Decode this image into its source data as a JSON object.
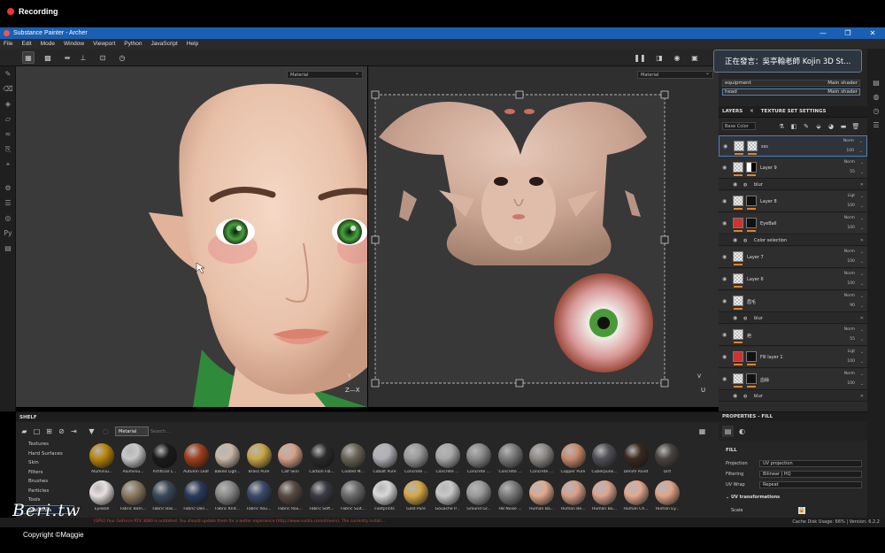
{
  "recording": {
    "label": "Recording"
  },
  "window": {
    "title": "Substance Painter - Archer",
    "minimize": "—",
    "maximize": "❐",
    "close": "✕"
  },
  "menu": [
    "File",
    "Edit",
    "Mode",
    "Window",
    "Viewport",
    "Python",
    "JavaScript",
    "Help"
  ],
  "viewport3d": {
    "mode": "Material"
  },
  "viewport2d": {
    "mode": "Material"
  },
  "notification": {
    "text": "正在發言：吳亭翰老師 Kojin 3D St..."
  },
  "texture_sets": [
    {
      "name": "equipment",
      "shader": "Main shader"
    },
    {
      "name": "head",
      "shader": "Main shader"
    }
  ],
  "layers_panel": {
    "tab_layers": "LAYERS",
    "tab_tss": "TEXTURE SET SETTINGS",
    "blend_select": "Base Color"
  },
  "layers": [
    {
      "name": "sss",
      "blend": "Norm",
      "opacity": "100",
      "kind": "main",
      "thumb": "checker",
      "mask": "checker",
      "selected": true
    },
    {
      "name": "Layer 9",
      "blend": "Norm",
      "opacity": "55",
      "kind": "main",
      "thumb": "checker",
      "mask": "mask"
    },
    {
      "name": "blur",
      "kind": "sub"
    },
    {
      "name": "Layer 8",
      "blend": "Ligt",
      "opacity": "100",
      "kind": "main",
      "thumb": "checker",
      "mask": "dark"
    },
    {
      "name": "EyeBall",
      "blend": "Norm",
      "opacity": "100",
      "kind": "main",
      "thumb": "red",
      "mask": "dark"
    },
    {
      "name": "Color selection",
      "kind": "sub"
    },
    {
      "name": "Layer 7",
      "blend": "Norm",
      "opacity": "100",
      "kind": "main",
      "thumb": "checker"
    },
    {
      "name": "Layer 6",
      "blend": "Norm",
      "opacity": "100",
      "kind": "main",
      "thumb": "checker"
    },
    {
      "name": "眉毛",
      "blend": "Norm",
      "opacity": "90",
      "kind": "main",
      "thumb": "checker"
    },
    {
      "name": "blur",
      "kind": "sub"
    },
    {
      "name": "疤",
      "blend": "Norm",
      "opacity": "55",
      "kind": "main",
      "thumb": "checker"
    },
    {
      "name": "Fill layer 1",
      "blend": "Ligt",
      "opacity": "100",
      "kind": "main",
      "thumb": "red",
      "mask": "dark"
    },
    {
      "name": "血絲",
      "blend": "Norm",
      "opacity": "100",
      "kind": "main",
      "thumb": "checker",
      "mask": "dark"
    },
    {
      "name": "blur",
      "kind": "sub"
    }
  ],
  "properties": {
    "header": "PROPERTIES - FILL",
    "section": "FILL",
    "rows": [
      {
        "label": "Projection",
        "value": "UV projection"
      },
      {
        "label": "Filtering",
        "value": "Bilinear | HQ"
      },
      {
        "label": "UV Wrap",
        "value": "Repeat"
      }
    ],
    "uv_transformations": "UV transformations",
    "scale_label": "Scale"
  },
  "shelf": {
    "header": "SHELF",
    "filter_chip": "Metarial",
    "search_placeholder": "Search...",
    "categories": [
      "Textures",
      "Hard Surfaces",
      "Skin",
      "Filters",
      "Brushes",
      "Particles",
      "Tools",
      "Materials"
    ],
    "selected_category": "Materials",
    "materials_row1": [
      {
        "name": "Aluminiu...",
        "color": "#b8860b"
      },
      {
        "name": "Aluminiu...",
        "color": "#c8c8c8"
      },
      {
        "name": "Artificial L...",
        "color": "#1a1a1a"
      },
      {
        "name": "Autumn Leaf",
        "color": "#a0401c"
      },
      {
        "name": "Baked Ligh...",
        "color": "#c9b8a6"
      },
      {
        "name": "Brass Pure",
        "color": "#c9a646"
      },
      {
        "name": "Calf Skin",
        "color": "#d6a288"
      },
      {
        "name": "Carbon Fib...",
        "color": "#2a2a2a"
      },
      {
        "name": "Coated M...",
        "color": "#6a6458"
      },
      {
        "name": "Cobalt Pure",
        "color": "#b0b0b8"
      },
      {
        "name": "Concrete ...",
        "color": "#9a9a9a"
      },
      {
        "name": "Concrete ...",
        "color": "#a8a8a8"
      },
      {
        "name": "Concrete ...",
        "color": "#8a8a8a"
      },
      {
        "name": "Concrete ...",
        "color": "#7a7a7a"
      },
      {
        "name": "Concrete ...",
        "color": "#8e8a84"
      },
      {
        "name": "Copper Pure",
        "color": "#c98a6a"
      },
      {
        "name": "Cuberpunk...",
        "color": "#505058"
      },
      {
        "name": "Denim Rivet",
        "color": "#3a2a1e"
      },
      {
        "name": "Dirt",
        "color": "#4a4440"
      }
    ],
    "materials_row2": [
      {
        "name": "EyeBall",
        "color": "#e8e0e0"
      },
      {
        "name": "Fabric Bam...",
        "color": "#8a7a60"
      },
      {
        "name": "Fabric Bas...",
        "color": "#3a4a5a"
      },
      {
        "name": "Fabric Den...",
        "color": "#2a3a5a"
      },
      {
        "name": "Fabric Knit...",
        "color": "#8a8a8a"
      },
      {
        "name": "Fabric Rou...",
        "color": "#3a4a6a"
      },
      {
        "name": "Fabric Rou...",
        "color": "#5a4a44"
      },
      {
        "name": "Fabric Soft...",
        "color": "#3a3a44"
      },
      {
        "name": "Fabric Suit...",
        "color": "#6a6a6a"
      },
      {
        "name": "Footprints",
        "color": "#d8d8d8"
      },
      {
        "name": "Gold Pure",
        "color": "#d4a846"
      },
      {
        "name": "Gouache P...",
        "color": "#c8c8c8"
      },
      {
        "name": "Ground Gr...",
        "color": "#9a9a9a"
      },
      {
        "name": "HB Noise ...",
        "color": "#7a7a7a"
      },
      {
        "name": "Human Ba...",
        "color": "#e0a88c"
      },
      {
        "name": "Human Be...",
        "color": "#d8a08a"
      },
      {
        "name": "Human Bu...",
        "color": "#dca490"
      },
      {
        "name": "Human Ch...",
        "color": "#e4a890"
      },
      {
        "name": "Human Ey...",
        "color": "#e0a488"
      }
    ]
  },
  "status": {
    "warning": "[GPU] Your GeForce RTX 3080 is outdated. You should update them for a better experience (http://www.nvidia.com/drivers). The currently install...",
    "right": "Cache Disk Usage: 66% | Version: 6.2.2"
  },
  "watermark": {
    "text": "Beri.tw",
    "copyright": "Copyright ©Maggie"
  },
  "colors": {
    "accent": "#1a5fb4",
    "orange": "#e0822a",
    "selection": "#4d7fbf",
    "warning": "#d24a3a"
  }
}
